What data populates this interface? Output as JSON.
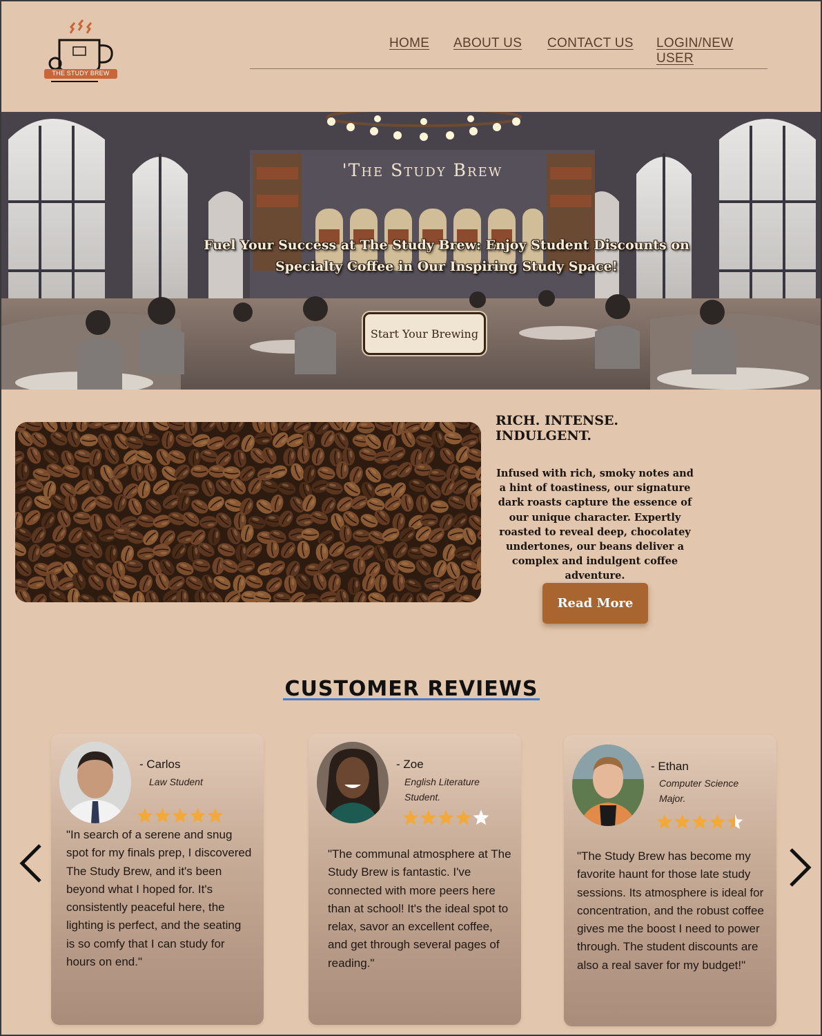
{
  "brand": {
    "logo_text": "THE STUDY BREW"
  },
  "nav": {
    "home": "HOME",
    "about": "ABOUT US",
    "contact": "CONTACT US",
    "login": "LOGIN/NEW USER"
  },
  "hero": {
    "sign": "'The Study Brew",
    "headline": "Fuel Your Success at The Study Brew: Enjoy Student Discounts on Specialty Coffee in Our Inspiring Study Space!",
    "cta": "Start Your Brewing"
  },
  "feature": {
    "title": "RICH. INTENSE. INDULGENT.",
    "body": "Infused with rich, smoky notes and a hint of toastiness, our signature dark roasts capture the essence of our unique character. Expertly roasted to reveal deep, chocolatey undertones, our beans deliver a complex and indulgent coffee adventure.",
    "button": "Read More"
  },
  "reviews": {
    "title": "CUSTOMER  REVIEWS",
    "items": [
      {
        "name": "- Carlos",
        "role": "Law Student",
        "rating": 5,
        "text": "\"In search of a serene and snug spot for my finals prep, I discovered The Study Brew, and it's been beyond what I hoped for. It's consistently peaceful here, the lighting is perfect, and the seating is so comfy that I can study for hours on end.\""
      },
      {
        "name": "- Zoe",
        "role": "English Literature Student.",
        "rating": 4,
        "text": "\"The communal atmosphere at The Study Brew is fantastic. I've connected with more peers here than at school! It's the ideal spot to relax, savor an excellent coffee, and get through several pages of reading.\""
      },
      {
        "name": "-  Ethan",
        "role": "Computer Science Major.",
        "rating": 4.5,
        "text": "\"The Study Brew has become my favorite haunt for those late study sessions. Its atmosphere is ideal for concentration, and the robust coffee gives me the boost I need to power through. The student discounts are also a real saver for my budget!\""
      }
    ]
  },
  "colors": {
    "page_bg": "#e2c6ad",
    "nav_text": "#5a3e2b",
    "read_more_bg": "#a9652f",
    "star_fill": "#f2a93b",
    "star_empty": "#ffffff",
    "title_underline": "#3f7ed8"
  },
  "icons": {
    "prev": "chevron-left-icon",
    "next": "chevron-right-icon",
    "logo": "coffee-cup-icon"
  }
}
